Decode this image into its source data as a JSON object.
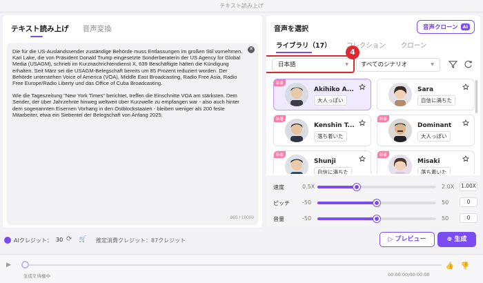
{
  "window": {
    "title": "テキスト読み上げ"
  },
  "left": {
    "tabs": [
      {
        "label": "テキスト読み上げ"
      },
      {
        "label": "音声変換"
      }
    ],
    "text": {
      "p1": "Die für die US-Auslandssender zuständige Behörde muss Entlassungen im großen Stil vornehmen. Kari Lake, die von Präsident Donald Trump eingesetzte Sonderberaterin der US Agency for Global Media (USAGM), schrieb im Kurznachrichtendienst X, 639 Beschäftigte hätten die Kündigung erhalten. Seit März sei die USAGM-Belegschaft bereits um 85 Prozent reduziert worden. Der Behörde unterstehen Voice of America (VOA), Middle East Broadcasting, Radio Free Asia, Radio Free Europe/Radio Liberty und das Office of Cuba Broadcasting.",
      "p2": "Wie die Tageszeitung \"New York Times\" berichtet, treffen die Einschnitte VOA am stärksten. Dem Sender, der über Jahrzehnte hinweg weltweit über Kurzwelle zu empfangen war - also auch hinter dem sogenannten Eisernen Vorhang in den Ostblockstaaten - bleiben weniger als 200 feste Mitarbeiter, etwa ein Siebentel der Belegschaft von Anfang 2025.",
      "counter": "865 / 10000"
    }
  },
  "right": {
    "title": "音声を選択",
    "clone_button": "音声クローン",
    "clone_badge": "AI",
    "tabs": [
      {
        "label": "ライブラリ（17）"
      },
      {
        "label": "コレクション"
      },
      {
        "label": "クローン"
      }
    ],
    "language": "日本語",
    "scenario": "すべてのシナリオ",
    "step_number": "4",
    "new_tag": "新着",
    "voices": [
      {
        "name": "Akihiko A...",
        "tag": "大人っぽい"
      },
      {
        "name": "Sara",
        "tag": "自信に満ちた"
      },
      {
        "name": "Kenshin T...",
        "tag": "落ち着いた"
      },
      {
        "name": "Dominant",
        "tag": "大人っぽい"
      },
      {
        "name": "Shunji",
        "tag": "自信に満ちた"
      },
      {
        "name": "Misaki",
        "tag": "落ち着いた"
      }
    ],
    "controls": {
      "speed": {
        "label": "速度",
        "min": "0.5X",
        "max": "2.0X",
        "value": "1.00X",
        "level": 0.33
      },
      "pitch": {
        "label": "ピッチ",
        "min": "-50",
        "max": "50",
        "value": "0",
        "level": 0.5
      },
      "volume": {
        "label": "音量",
        "min": "-50",
        "max": "50",
        "value": "0",
        "level": 0.5
      }
    }
  },
  "bottom": {
    "credit_label": "AIクレジット：",
    "credit_value": "30",
    "estimate": "推定消費クレジット：87クレジット",
    "preview": "プレビュー",
    "generate": "生成"
  },
  "player": {
    "status": "生成を待機中",
    "time": "00:00:00/00:00:00"
  },
  "colors": {
    "accent": "#7a4cf2",
    "highlight": "#e0262f",
    "new_tag": "#ff7aa8"
  }
}
